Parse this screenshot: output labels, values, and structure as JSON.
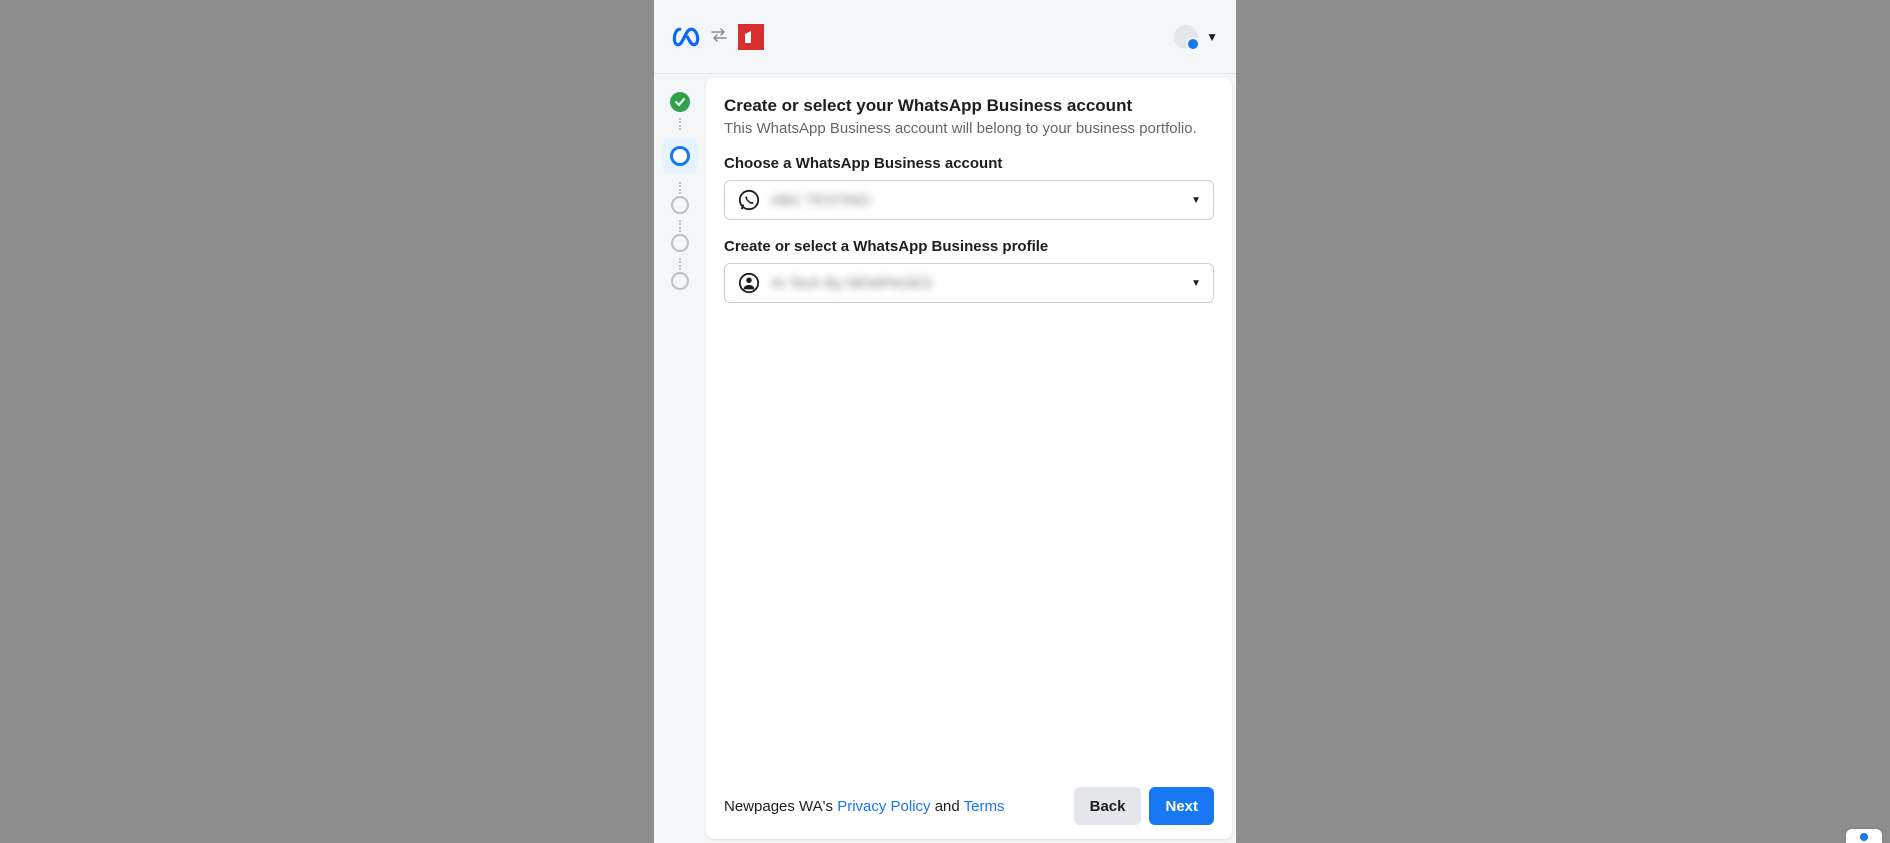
{
  "header": {
    "meta_logo": "meta",
    "partner_logo": "newpages"
  },
  "stepper": {
    "steps": [
      "completed",
      "active",
      "pending",
      "pending",
      "pending"
    ]
  },
  "content": {
    "title": "Create or select your WhatsApp Business account",
    "subtitle": "This WhatsApp Business account will belong to your business portfolio.",
    "field1": {
      "label": "Choose a WhatsApp Business account",
      "value": "ABC TESTING"
    },
    "field2": {
      "label": "Create or select a WhatsApp Business profile",
      "value": "AI Tech By NEWPAGES"
    }
  },
  "footer": {
    "prefix": "Newpages WA's ",
    "privacy": "Privacy Policy",
    "and": " and ",
    "terms": "Terms",
    "back": "Back",
    "next": "Next"
  }
}
